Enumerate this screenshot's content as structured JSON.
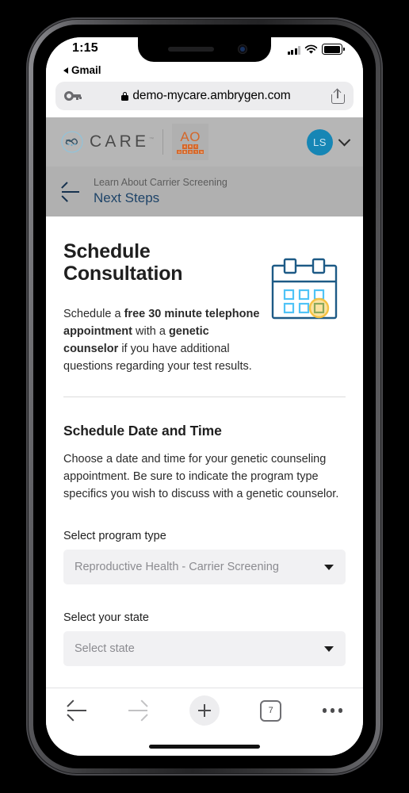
{
  "status_bar": {
    "time": "1:15",
    "back_app_label": "Gmail",
    "signal_icon": "cellular-signal-icon",
    "wifi_icon": "wifi-icon",
    "battery_icon": "battery-icon"
  },
  "browser": {
    "url": "demo-mycare.ambrygen.com",
    "lock_icon": "lock-icon",
    "passwords_icon": "key-icon",
    "share_icon": "share-icon",
    "toolbar": {
      "back_icon": "back-arrow-icon",
      "forward_icon": "forward-arrow-icon",
      "new_tab_icon": "plus-icon",
      "tab_count": "7",
      "more_icon": "more-dots-icon"
    }
  },
  "site_header": {
    "brand_word": "CARE",
    "brand_mark": "care-infinity-logo",
    "trademark": "™",
    "partner_logo": {
      "name": "ao-obgyn-logo",
      "word": "AO",
      "row1": [
        "A",
        "B",
        "C"
      ],
      "row2": [
        "O",
        "B",
        "G",
        "Y",
        "N"
      ]
    },
    "avatar_initials": "LS",
    "chevron_icon": "chevron-down-icon",
    "band_color": "#b6b6b6"
  },
  "page_nav": {
    "back_icon": "back-arrow-icon",
    "breadcrumb": "Learn About Carrier Screening",
    "title": "Next Steps",
    "band_color": "#b0b0b0",
    "title_color": "#1d4368"
  },
  "main": {
    "heading": "Schedule Consultation",
    "intro": {
      "pre": "Schedule a ",
      "bold1": "free 30 minute telephone appointment",
      "mid": " with a ",
      "bold2": "genetic counselor",
      "post": " if you have additional questions regarding your test results."
    },
    "calendar_icon": {
      "name": "calendar-icon",
      "outline_color": "#1d5a86",
      "cell_color": "#4fc3f7",
      "highlight_color": "#f5c243"
    },
    "section2": {
      "heading": "Schedule Date and Time",
      "body": "Choose a date and time for your genetic counseling appointment. Be sure to indicate the program type specifics you wish to discuss with a genetic counselor."
    },
    "fields": [
      {
        "label": "Select program type",
        "value": "Reproductive Health - Carrier Screening",
        "caret_icon": "caret-down-icon"
      },
      {
        "label": "Select your state",
        "value": "Select state",
        "caret_icon": "caret-down-icon"
      }
    ]
  }
}
